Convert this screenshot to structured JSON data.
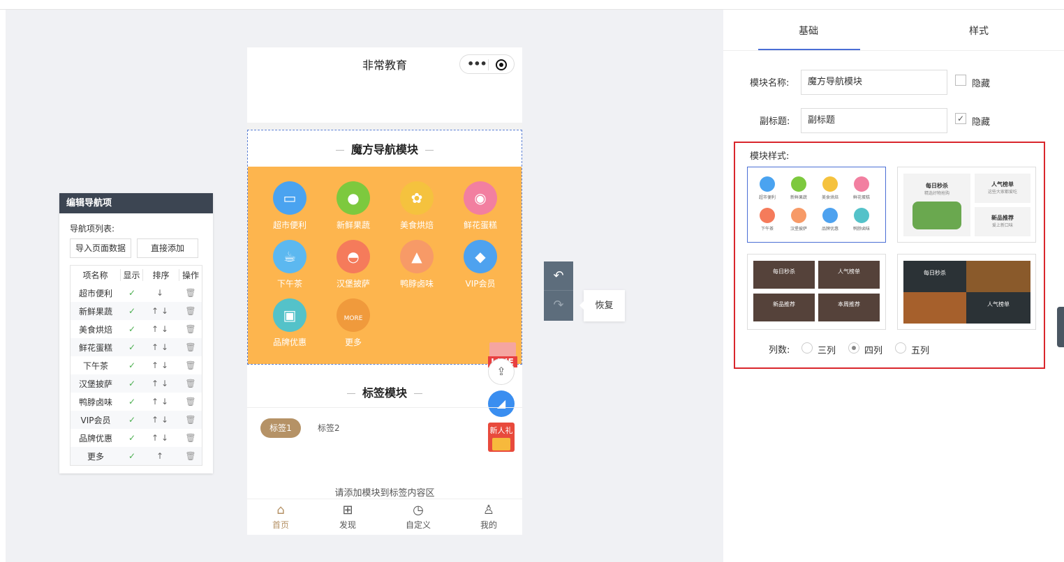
{
  "nav_panel": {
    "title": "编辑导航项",
    "list_label": "导航项列表:",
    "import_btn": "导入页面数据",
    "add_btn": "直接添加",
    "columns": [
      "项名称",
      "显示",
      "排序",
      "操作"
    ],
    "rows": [
      {
        "name": "超市便利",
        "sort": "↓"
      },
      {
        "name": "新鲜果蔬",
        "sort": "↑↓"
      },
      {
        "name": "美食烘焙",
        "sort": "↑↓"
      },
      {
        "name": "鲜花蛋糕",
        "sort": "↑↓"
      },
      {
        "name": "下午茶",
        "sort": "↑↓"
      },
      {
        "name": "汉堡披萨",
        "sort": "↑↓"
      },
      {
        "name": "鸭脖卤味",
        "sort": "↑↓"
      },
      {
        "name": "VIP会员",
        "sort": "↑↓"
      },
      {
        "name": "品牌优惠",
        "sort": "↑↓"
      },
      {
        "name": "更多",
        "sort": "↑"
      }
    ]
  },
  "phone": {
    "title": "非常教育",
    "cube_title": "魔方导航模块",
    "items": [
      {
        "label": "超市便利",
        "color": "#4aa3f0"
      },
      {
        "label": "新鲜果蔬",
        "color": "#7dc93e"
      },
      {
        "label": "美食烘焙",
        "color": "#f5c23e"
      },
      {
        "label": "鲜花蛋糕",
        "color": "#f27fa0"
      },
      {
        "label": "下午茶",
        "color": "#5cb8f0"
      },
      {
        "label": "汉堡披萨",
        "color": "#f57b5b"
      },
      {
        "label": "鸭脖卤味",
        "color": "#f79a67"
      },
      {
        "label": "VIP会员",
        "color": "#4ea2ef"
      },
      {
        "label": "品牌优惠",
        "color": "#54c2c9"
      },
      {
        "label": "更多",
        "color": "#f09a3c",
        "icon_text": "MORE"
      }
    ],
    "live_text": "LIVE",
    "tab_module_title": "标签模块",
    "tag1": "标签1",
    "tag2": "标签2",
    "hint": "请添加模块到标签内容区",
    "gift_text": "新人礼",
    "tabbar": [
      "首页",
      "发现",
      "自定义",
      "我的"
    ]
  },
  "undo": {
    "tooltip": "恢复"
  },
  "right_panel": {
    "tabs": [
      "基础",
      "样式"
    ],
    "module_name_label": "模块名称:",
    "module_name_value": "魔方导航模块",
    "hide_label": "隐藏",
    "subtitle_label": "副标题:",
    "subtitle_value": "副标题",
    "hide_label2": "隐藏",
    "style_label": "模块样式:",
    "mini_items": [
      "超市便利",
      "新鲜果蔬",
      "美食烘焙",
      "鲜花蛋糕",
      "下午茶",
      "汉堡披萨",
      "品牌优惠",
      "鸭脖卤味"
    ],
    "card2": {
      "t1": "每日秒杀",
      "t2": "人气榜单",
      "t3": "新品推荐",
      "s1": "精选好物抢购",
      "s2": "这些大家都爱吃",
      "s3": "爱上新口味"
    },
    "card3": {
      "t1": "每日秒杀",
      "t2": "人气榜单",
      "t3": "新品推荐",
      "t4": "本周推荐"
    },
    "card4": {
      "t1": "每日秒杀",
      "t2": "人气榜单"
    },
    "columns_label": "列数:",
    "col_opts": [
      "三列",
      "四列",
      "五列"
    ]
  }
}
